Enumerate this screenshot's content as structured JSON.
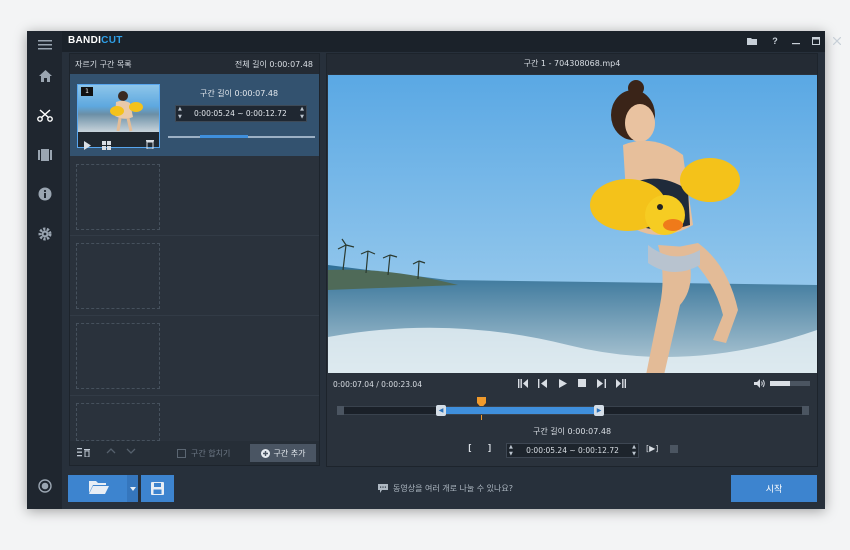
{
  "app": {
    "logo_main": "BANDI",
    "logo_accent": "CUT"
  },
  "titlebar": {
    "icons": [
      "folder-icon",
      "help-icon",
      "minimize-icon",
      "maximize-icon",
      "close-icon"
    ],
    "help_label": "?"
  },
  "sidebar": {
    "items": [
      "menu-icon",
      "home-icon",
      "cut-icon",
      "film-icon",
      "info-icon",
      "settings-icon",
      "record-icon"
    ]
  },
  "left_panel": {
    "title": "자르기 구간 목록",
    "total_label": "전체 길이 0:00:07.48",
    "segment": {
      "number": "1",
      "duration_label": "구간 길이 0:00:07.48",
      "range": "0:00:05.24 ~ 0:00:12.72"
    },
    "footer": {
      "merge_label": "구간 합치기",
      "add_label": "구간 추가"
    }
  },
  "right_panel": {
    "title": "구간 1 - 704308068.mp4",
    "time_display": "0:00:07.04 / 0:00:23.04",
    "segment_length": "구간 길이 0:00:07.48",
    "range": "0:00:05.24 ~ 0:00:12.72",
    "start_bracket": "[",
    "end_bracket": "]",
    "play_range": "[▶]",
    "volume_level": 0.5
  },
  "bottom": {
    "help_text": "동영상을 여러 개로 나눌 수 있나요?",
    "start_label": "시작"
  },
  "colors": {
    "accent": "#3d84cf",
    "selected_row": "#33526f",
    "background": "#27303b"
  }
}
